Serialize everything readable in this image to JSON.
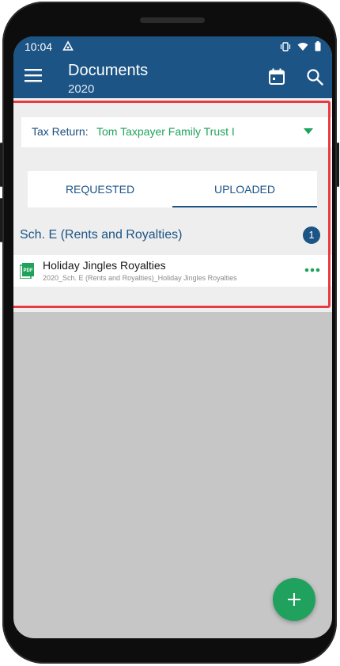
{
  "status_bar": {
    "time": "10:04"
  },
  "app_bar": {
    "title": "Documents",
    "subtitle": "2020"
  },
  "tax_return": {
    "label": "Tax Return:",
    "value": "Tom Taxpayer Family Trust I"
  },
  "tabs": [
    {
      "label": "REQUESTED",
      "selected": false
    },
    {
      "label": "UPLOADED",
      "selected": true
    }
  ],
  "section": {
    "title": "Sch. E (Rents and Royalties)",
    "count": "1"
  },
  "documents": [
    {
      "title": "Holiday Jingles Royalties",
      "filename": "2020_Sch. E (Rents and Royalties)_Holiday Jingles Royalties"
    }
  ],
  "colors": {
    "primary": "#1c5486",
    "accent": "#1fa35c",
    "highlight": "#e93a43"
  },
  "icons": [
    "menu-icon",
    "calendar-icon",
    "search-icon",
    "dropdown-arrow-icon",
    "pdf-icon",
    "more-options-icon",
    "add-icon"
  ]
}
